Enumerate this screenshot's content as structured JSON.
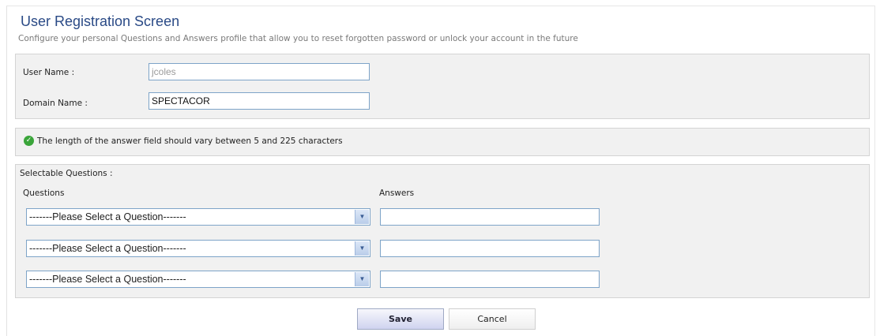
{
  "header": {
    "title": "User Registration Screen",
    "subtitle": "Configure your personal Questions and Answers profile that allow you to reset forgotten password or unlock your account in the future"
  },
  "account": {
    "user_label": "User Name :",
    "user_value": "jcoles",
    "domain_label": "Domain Name :",
    "domain_value": "SPECTACOR"
  },
  "notice": {
    "text": "The length of the answer field should vary between 5 and 225 characters",
    "icon": "check-icon",
    "icon_color": "#3aa53a"
  },
  "questions": {
    "section_label": "Selectable Questions :",
    "col_questions": "Questions",
    "col_answers": "Answers",
    "rows": [
      {
        "question": "-------Please Select a Question-------",
        "answer": ""
      },
      {
        "question": "-------Please Select a Question-------",
        "answer": ""
      },
      {
        "question": "-------Please Select a Question-------",
        "answer": ""
      }
    ]
  },
  "buttons": {
    "save": "Save",
    "cancel": "Cancel"
  },
  "colors": {
    "title": "#2a4a86",
    "field_border": "#7ea4c8",
    "panel_bg": "#f1f1f1"
  }
}
